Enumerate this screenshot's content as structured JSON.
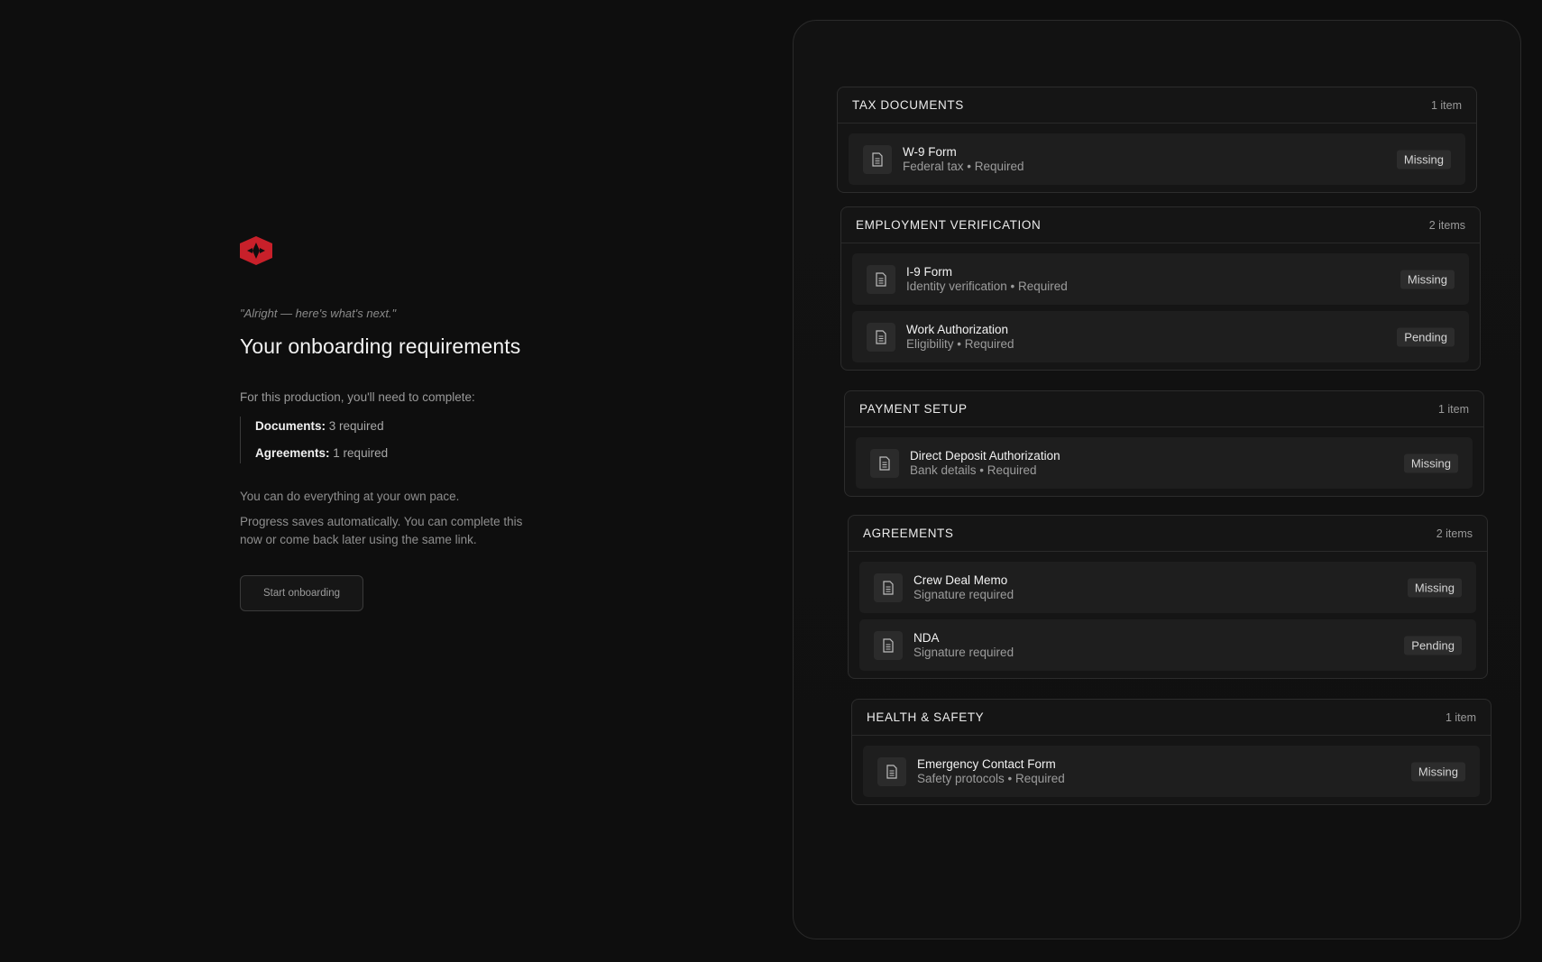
{
  "left": {
    "quote": "\"Alright — here's what's next.\"",
    "title": "Your onboarding requirements",
    "intro": "For this production, you'll need to complete:",
    "requirements": [
      {
        "label": "Documents:",
        "value": "3 required"
      },
      {
        "label": "Agreements:",
        "value": "1 required"
      }
    ],
    "pace_note": "You can do everything at your own pace.",
    "progress_note": "Progress saves automatically. You can complete this now or come back later using the same link.",
    "start_button": "Start onboarding"
  },
  "sections": [
    {
      "title": "TAX DOCUMENTS",
      "count": "1 item",
      "items": [
        {
          "name": "W-9 Form",
          "sub": "Federal tax • Required",
          "status": "Missing"
        }
      ]
    },
    {
      "title": "EMPLOYMENT VERIFICATION",
      "count": "2 items",
      "items": [
        {
          "name": "I-9 Form",
          "sub": "Identity verification • Required",
          "status": "Missing"
        },
        {
          "name": "Work Authorization",
          "sub": "Eligibility • Required",
          "status": "Pending"
        }
      ]
    },
    {
      "title": "PAYMENT SETUP",
      "count": "1 item",
      "items": [
        {
          "name": "Direct Deposit Authorization",
          "sub": "Bank details • Required",
          "status": "Missing"
        }
      ]
    },
    {
      "title": "AGREEMENTS",
      "count": "2 items",
      "items": [
        {
          "name": "Crew Deal Memo",
          "sub": "Signature required",
          "status": "Missing"
        },
        {
          "name": "NDA",
          "sub": "Signature required",
          "status": "Pending"
        }
      ]
    },
    {
      "title": "HEALTH & SAFETY",
      "count": "1 item",
      "items": [
        {
          "name": "Emergency Contact Form",
          "sub": "Safety protocols • Required",
          "status": "Missing"
        }
      ]
    }
  ],
  "icons": {
    "logo": "brand-logo-icon",
    "document": "document-icon"
  },
  "colors": {
    "brand": "#c8202a",
    "background": "#0e0e0e"
  }
}
